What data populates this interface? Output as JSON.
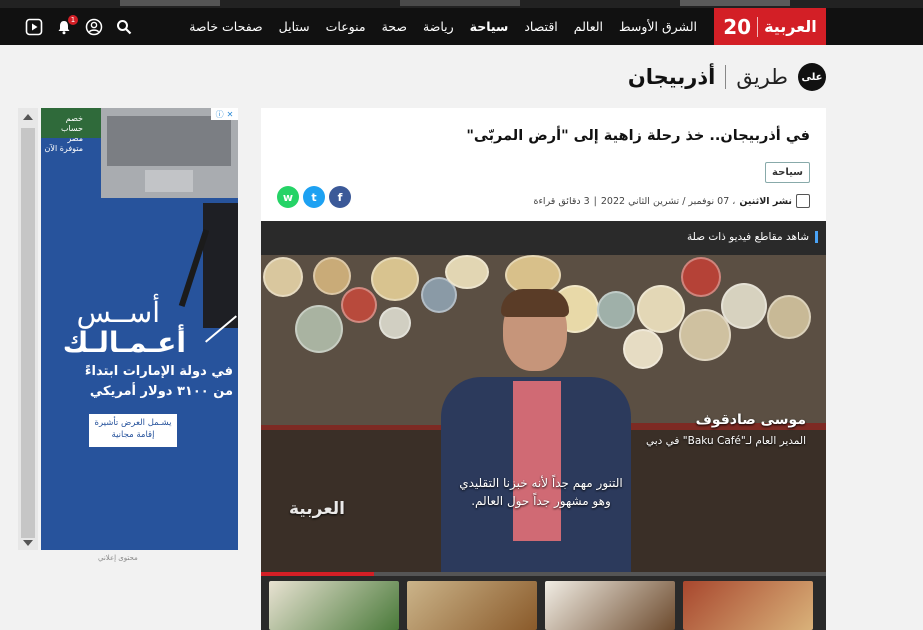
{
  "colors": {
    "brand_red": "#d31f26",
    "nav_bg": "#111111",
    "page_bg": "#f2f2f2",
    "facebook": "#3b5998",
    "twitter": "#1da1f2",
    "whatsapp": "#25d366",
    "ad_blue": "#27539c"
  },
  "header": {
    "logo_number": "20",
    "logo_brand": "العربية",
    "nav_items": [
      {
        "label": "الشرق الأوسط",
        "active": false
      },
      {
        "label": "العالم",
        "active": false
      },
      {
        "label": "اقتصاد",
        "active": false
      },
      {
        "label": "سياحة",
        "active": true
      },
      {
        "label": "رياضة",
        "active": false
      },
      {
        "label": "صحة",
        "active": false
      },
      {
        "label": "منوعات",
        "active": false
      },
      {
        "label": "ستايل",
        "active": false
      },
      {
        "label": "صفحات خاصة",
        "active": false
      }
    ],
    "icons": [
      "play-icon",
      "bell-icon",
      "user-icon",
      "search-icon"
    ],
    "notification_count": "1"
  },
  "section": {
    "badge": "على",
    "series_word": "طريق",
    "series_title": "أذربيجان"
  },
  "article": {
    "headline": "في أذربيجان.. خذ رحلة زاهية إلى \"أرض المربّى\"",
    "tag": "سياحة",
    "meta_label": "نشر الاثنين",
    "meta_date": "، 07 نوفمبر / تشرين الثاني 2022",
    "meta_sep": "|",
    "meta_read": "3 دقائق قراءة",
    "share": [
      {
        "icon": "facebook-icon",
        "glyph": "f"
      },
      {
        "icon": "twitter-icon",
        "glyph": "t"
      },
      {
        "icon": "whatsapp-icon",
        "glyph": "w"
      }
    ]
  },
  "video": {
    "section_title": "شاهد مقاطع فيديو ذات صلة",
    "speaker_name": "موسى صادقوف",
    "speaker_role": "المدير العام لـ\"Baku Café\" في دبي",
    "subtitle_line1": "التنور مهم جداً لأنه خبزنا التقليدي",
    "subtitle_line2": "وهو مشهور جداً حول العالم.",
    "watermark": "العربية",
    "progress": 0.2
  },
  "ad": {
    "corner_text": "خصم حساب مصر متوفرة الآن",
    "headline1": "أســس",
    "headline2": "أعـمـالـك",
    "line3": "في دولة الإمارات ابتداءً",
    "line4": "من ٣١٠٠ دولار أمريكي",
    "cta": "يشـمل العرض تأشيرة إقامة مجانية",
    "label": "محتوى إعلاني"
  }
}
